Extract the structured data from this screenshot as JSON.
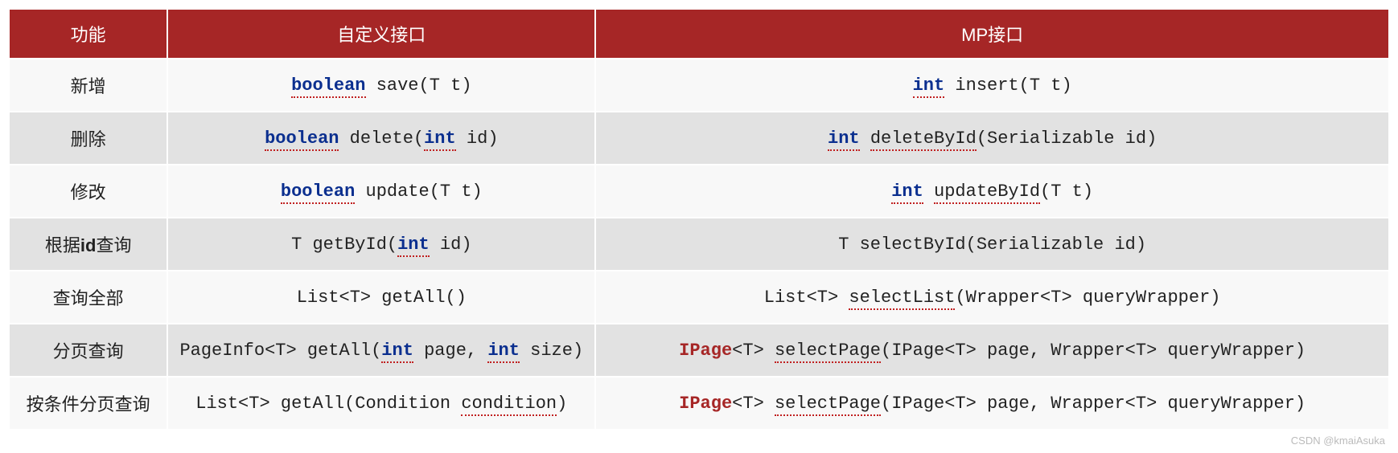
{
  "headers": {
    "func": "功能",
    "custom": "自定义接口",
    "mp": "MP接口"
  },
  "rows": [
    {
      "func": "新增",
      "custom": [
        {
          "t": "boolean",
          "c": "kw-blue"
        },
        {
          "t": " save(T t)",
          "c": ""
        }
      ],
      "mp": [
        {
          "t": "int",
          "c": "kw-blue"
        },
        {
          "t": " insert(T t)",
          "c": ""
        }
      ]
    },
    {
      "func": "删除",
      "custom": [
        {
          "t": "boolean",
          "c": "kw-blue"
        },
        {
          "t": " delete(",
          "c": ""
        },
        {
          "t": "int",
          "c": "kw-blue"
        },
        {
          "t": " id)",
          "c": ""
        }
      ],
      "mp": [
        {
          "t": "int",
          "c": "kw-blue"
        },
        {
          "t": " ",
          "c": ""
        },
        {
          "t": "deleteById",
          "c": "squig"
        },
        {
          "t": "(Serializable id)",
          "c": ""
        }
      ]
    },
    {
      "func": "修改",
      "custom": [
        {
          "t": "boolean",
          "c": "kw-blue"
        },
        {
          "t": " update(T t)",
          "c": ""
        }
      ],
      "mp": [
        {
          "t": "int",
          "c": "kw-blue"
        },
        {
          "t": " ",
          "c": ""
        },
        {
          "t": "updateById",
          "c": "squig"
        },
        {
          "t": "(T t)",
          "c": ""
        }
      ]
    },
    {
      "func_parts": [
        {
          "t": "根据",
          "c": ""
        },
        {
          "t": "id",
          "c": "bold"
        },
        {
          "t": "查询",
          "c": ""
        }
      ],
      "custom": [
        {
          "t": "T getById(",
          "c": ""
        },
        {
          "t": "int",
          "c": "kw-blue"
        },
        {
          "t": " id)",
          "c": ""
        }
      ],
      "mp": [
        {
          "t": "T selectById(Serializable id)",
          "c": ""
        }
      ]
    },
    {
      "func": "查询全部",
      "custom": [
        {
          "t": "List<T> getAll()",
          "c": ""
        }
      ],
      "mp": [
        {
          "t": "List<T> ",
          "c": ""
        },
        {
          "t": "selectList",
          "c": "squig"
        },
        {
          "t": "(Wrapper<T> queryWrapper)",
          "c": ""
        }
      ]
    },
    {
      "func": "分页查询",
      "custom": [
        {
          "t": "PageInfo<T> getAll(",
          "c": ""
        },
        {
          "t": "int",
          "c": "kw-blue"
        },
        {
          "t": " page, ",
          "c": ""
        },
        {
          "t": "int",
          "c": "kw-blue"
        },
        {
          "t": " size)",
          "c": ""
        }
      ],
      "mp": [
        {
          "t": "IPage",
          "c": "kw-red"
        },
        {
          "t": "<T> ",
          "c": ""
        },
        {
          "t": "selectPage",
          "c": "squig"
        },
        {
          "t": "(IPage<T> page, Wrapper<T> queryWrapper)",
          "c": ""
        }
      ]
    },
    {
      "func": "按条件分页查询",
      "custom": [
        {
          "t": "List<T> getAll(Condition ",
          "c": ""
        },
        {
          "t": "condition",
          "c": "squig"
        },
        {
          "t": ")",
          "c": ""
        }
      ],
      "mp": [
        {
          "t": "IPage",
          "c": "kw-red"
        },
        {
          "t": "<T> ",
          "c": ""
        },
        {
          "t": "selectPage",
          "c": "squig"
        },
        {
          "t": "(IPage<T> page, Wrapper<T> queryWrapper)",
          "c": ""
        }
      ]
    }
  ],
  "watermark": "CSDN @kmaiAsuka"
}
